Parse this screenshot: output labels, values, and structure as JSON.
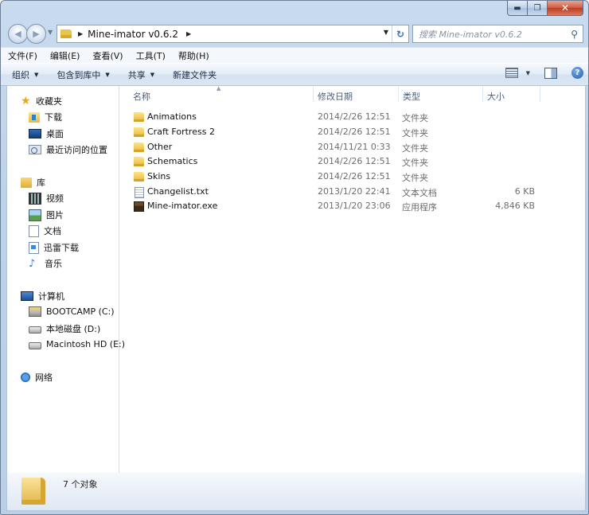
{
  "window": {
    "caption_min": "▬",
    "caption_max": "❐",
    "caption_close": "✕"
  },
  "nav": {
    "path": "Mine-imator v0.6.2",
    "search_placeholder": "搜索 Mine-imator v0.6.2"
  },
  "menu": [
    "文件(F)",
    "编辑(E)",
    "查看(V)",
    "工具(T)",
    "帮助(H)"
  ],
  "toolbar": {
    "organize": "组织",
    "include_in_library": "包含到库中",
    "share": "共享",
    "new_folder": "新建文件夹"
  },
  "sidebar": {
    "favorites": {
      "label": "收藏夹",
      "items": [
        "下载",
        "桌面",
        "最近访问的位置"
      ]
    },
    "libraries": {
      "label": "库",
      "items": [
        "视频",
        "图片",
        "文档",
        "迅雷下载",
        "音乐"
      ]
    },
    "computer": {
      "label": "计算机",
      "items": [
        "BOOTCAMP (C:)",
        "本地磁盘 (D:)",
        "Macintosh HD (E:)"
      ]
    },
    "network": {
      "label": "网络"
    }
  },
  "columns": {
    "name": "名称",
    "date": "修改日期",
    "type": "类型",
    "size": "大小"
  },
  "files": [
    {
      "name": "Animations",
      "date": "2014/2/26 12:51",
      "type": "文件夹",
      "size": "",
      "icon": "folder"
    },
    {
      "name": "Craft Fortress 2",
      "date": "2014/2/26 12:51",
      "type": "文件夹",
      "size": "",
      "icon": "folder"
    },
    {
      "name": "Other",
      "date": "2014/11/21 0:33",
      "type": "文件夹",
      "size": "",
      "icon": "folder"
    },
    {
      "name": "Schematics",
      "date": "2014/2/26 12:51",
      "type": "文件夹",
      "size": "",
      "icon": "folder"
    },
    {
      "name": "Skins",
      "date": "2014/2/26 12:51",
      "type": "文件夹",
      "size": "",
      "icon": "folder"
    },
    {
      "name": "Changelist.txt",
      "date": "2013/1/20 22:41",
      "type": "文本文档",
      "size": "6 KB",
      "icon": "text-file"
    },
    {
      "name": "Mine-imator.exe",
      "date": "2013/1/20 23:06",
      "type": "应用程序",
      "size": "4,846 KB",
      "icon": "exe-file"
    }
  ],
  "status": {
    "count": "7 个对象"
  }
}
